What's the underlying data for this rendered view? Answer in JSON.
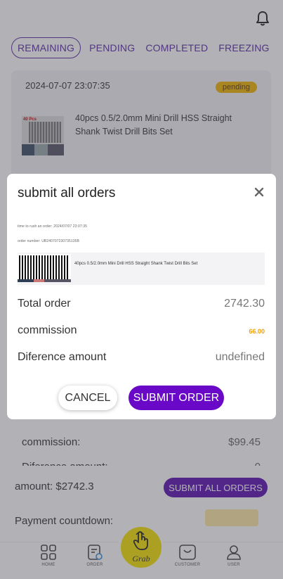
{
  "tabs": [
    "REMAINING",
    "PENDING",
    "COMPLETED",
    "FREEZING"
  ],
  "order": {
    "time": "2024-07-07 23:07:35",
    "status": "pending",
    "image_label": "40 Pcs",
    "title": "40pcs 0.5/2.0mm Mini Drill HSS Straight Shank Twist Drill Bits Set"
  },
  "background_rows": {
    "commission_label": "commission:",
    "commission_value": "$99.45",
    "difference_label": "Diference amount:",
    "difference_value": "0"
  },
  "footer": {
    "amount": "amount:  $2742.3",
    "submit_all": "SUBMIT ALL ORDERS",
    "countdown_label": "Payment countdown:"
  },
  "tabbar": {
    "home": "HOME",
    "order": "ORDER",
    "grab": "Grab",
    "customer": "CUSTOMER",
    "user": "USER"
  },
  "modal": {
    "title": "submit all orders",
    "rush_time": "time to rush an order:  2024/07/07 23:07:35",
    "order_number": "order number: UB240707230735135B",
    "product_name": "40pcs 0.5/2.0mm Mini Drill HSS Straight Shank Twist Drill Bits Set",
    "total_label": "Total order",
    "total_value": "2742.30",
    "commission_label": "commission",
    "commission_value": "66.00",
    "difference_label": "Diference amount",
    "difference_value": "undefined",
    "cancel": "CANCEL",
    "submit": "SUBMIT ORDER"
  },
  "colors": {
    "accent": "#5a2ca0",
    "primary_button": "#6a08c8",
    "badge": "#f2b600",
    "grab": "#f6e200",
    "commission": "#f0a000"
  },
  "icons": [
    "bell-icon",
    "close-icon",
    "home-icon",
    "order-icon",
    "grab-hand-icon",
    "customer-icon",
    "user-icon"
  ]
}
